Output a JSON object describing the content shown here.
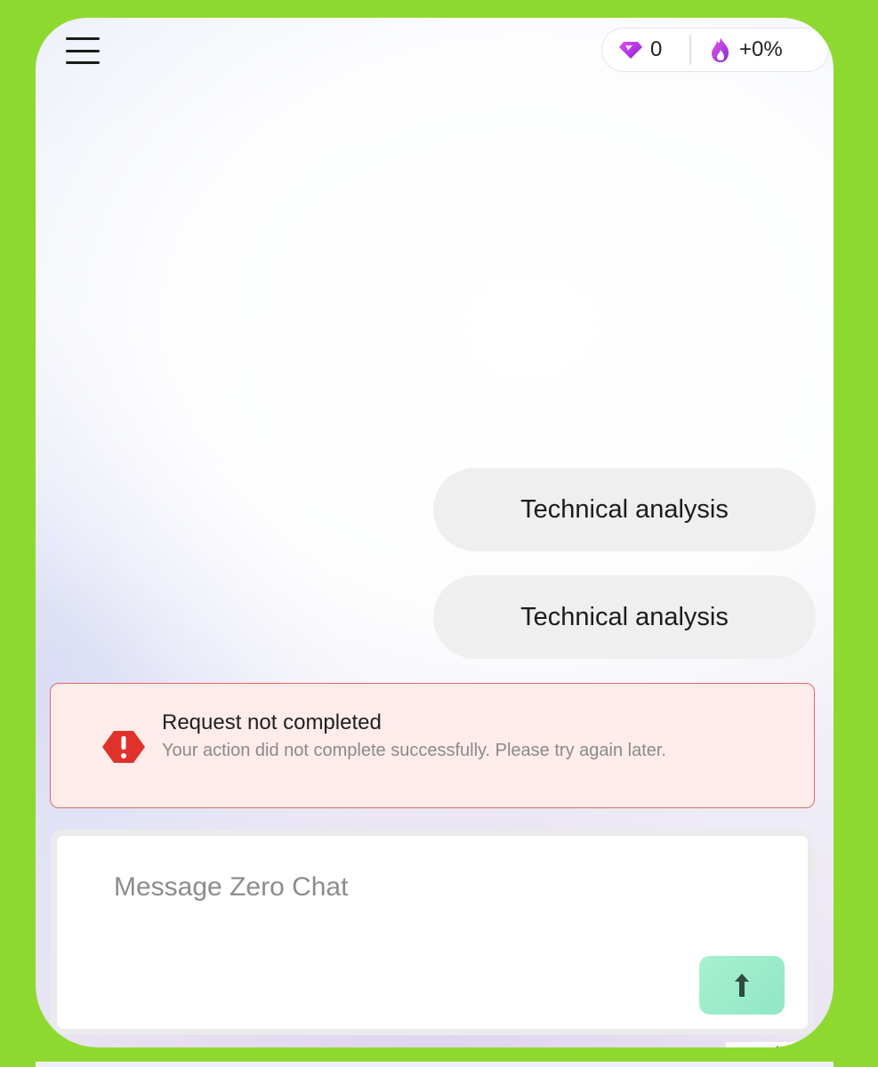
{
  "header": {
    "menu_icon": "hamburger-menu-icon",
    "gems": {
      "icon": "diamond-icon",
      "value": "0"
    },
    "streak": {
      "icon": "flame-icon",
      "value": "+0%"
    }
  },
  "messages": [
    {
      "role": "user",
      "text": "Technical analysis"
    },
    {
      "role": "user",
      "text": "Technical analysis"
    }
  ],
  "error": {
    "icon": "warning-icon",
    "title": "Request not completed",
    "text": "Your action did not complete successfully. Please try again later."
  },
  "composer": {
    "placeholder": "Message Zero Chat",
    "value": "",
    "send_icon": "arrow-up-icon"
  },
  "colors": {
    "frame": "#8ed92f",
    "accent_gem": "#c227e0",
    "error_red": "#e0322b",
    "send_button": "#a8f0cf"
  }
}
